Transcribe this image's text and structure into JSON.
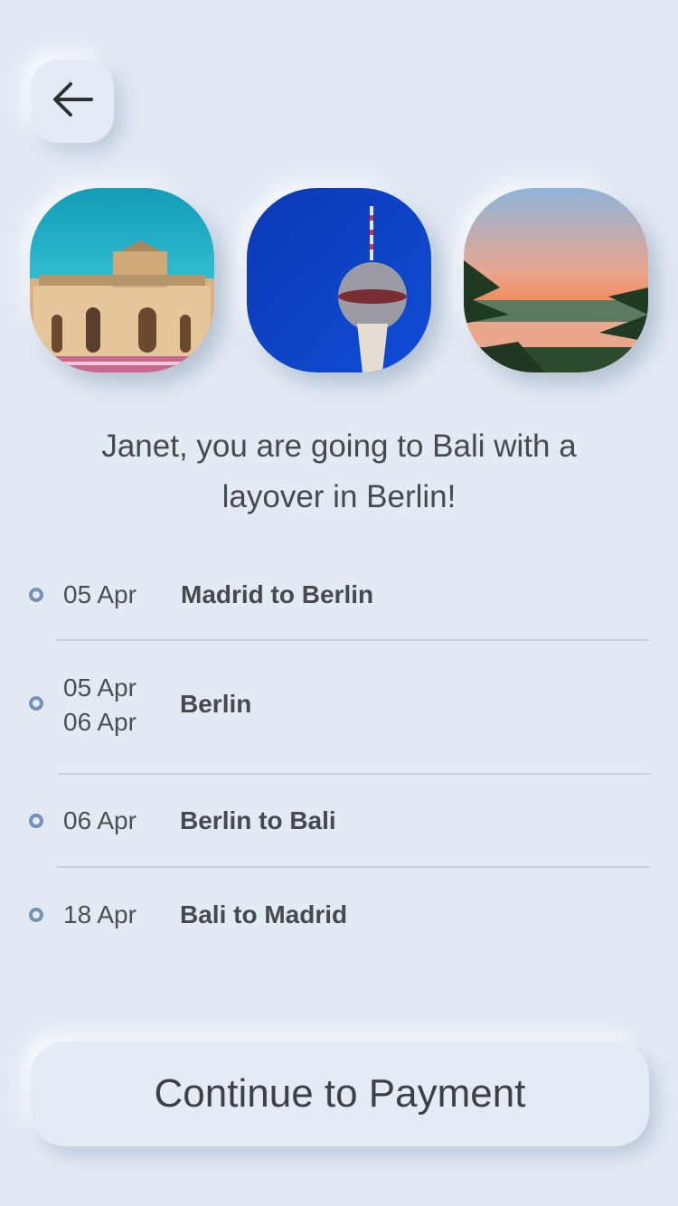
{
  "header": {
    "back_icon": "arrow-left-icon"
  },
  "photos": [
    {
      "subject": "Puerta de Alcalá, Madrid"
    },
    {
      "subject": "Berlin TV Tower"
    },
    {
      "subject": "Bali sunset lake with palms"
    }
  ],
  "headline": {
    "line1": "Janet, you are going to Bali with a",
    "line2": "layover in Berlin!"
  },
  "itinerary": [
    {
      "date": "05 Apr",
      "route": "Madrid to Berlin"
    },
    {
      "date": "05 Apr",
      "date2": "06 Apr",
      "route": "Berlin"
    },
    {
      "date": "06 Apr",
      "route": "Berlin to Bali"
    },
    {
      "date": "18 Apr",
      "route": "Bali to Madrid"
    }
  ],
  "cta": {
    "label": "Continue to Payment"
  },
  "colors": {
    "background": "#e2eaf4",
    "dot": "#7591b3",
    "text": "#48494d"
  }
}
